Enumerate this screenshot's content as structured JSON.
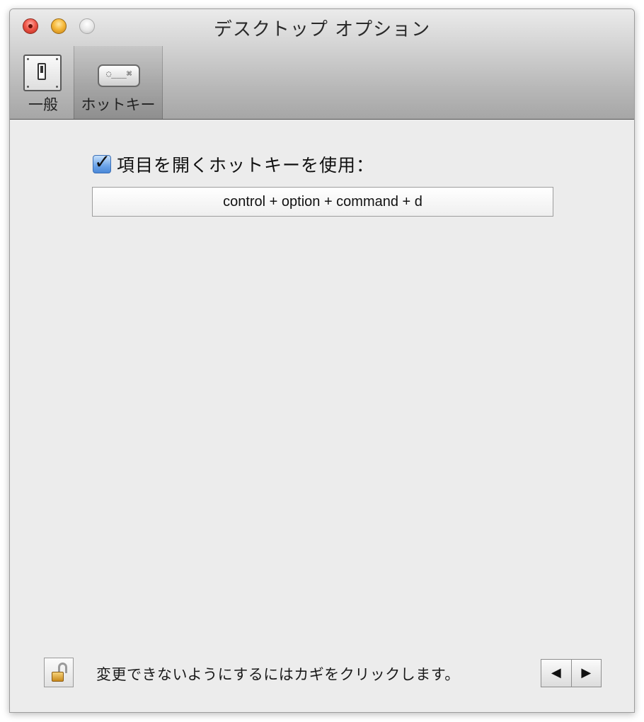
{
  "window": {
    "title": "デスクトップ オプション"
  },
  "toolbar": {
    "items": [
      {
        "label": "一般",
        "icon": "switch-icon"
      },
      {
        "label": "ホットキー",
        "icon": "keyboard-key-icon",
        "icon_text": "◌___⌘",
        "selected": true
      }
    ]
  },
  "hotkey": {
    "checkbox_label": "項目を開くホットキーを使用：",
    "checked": true,
    "shortcut": "control + option + command + d"
  },
  "footer": {
    "lock_text": "変更できないようにするにはカギをクリックします。",
    "prev": "◀",
    "next": "▶"
  }
}
